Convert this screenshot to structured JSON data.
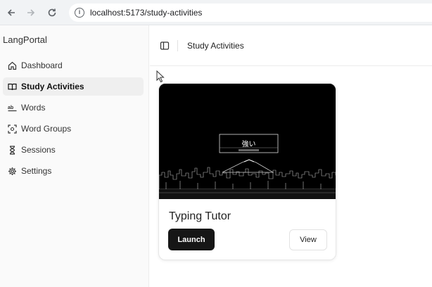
{
  "browser": {
    "url": "localhost:5173/study-activities",
    "back_icon": "arrow-left-icon",
    "forward_icon": "arrow-right-icon",
    "reload_icon": "reload-icon"
  },
  "sidebar": {
    "brand": "LangPortal",
    "items": [
      {
        "label": "Dashboard",
        "icon": "home-icon",
        "active": false
      },
      {
        "label": "Study Activities",
        "icon": "book-open-icon",
        "active": true
      },
      {
        "label": "Words",
        "icon": "whole-word-icon",
        "active": false
      },
      {
        "label": "Word Groups",
        "icon": "word-groups-icon",
        "active": false
      },
      {
        "label": "Sessions",
        "icon": "hourglass-icon",
        "active": false
      },
      {
        "label": "Settings",
        "icon": "gear-icon",
        "active": false
      }
    ]
  },
  "header": {
    "title": "Study Activities"
  },
  "activities": [
    {
      "title": "Typing Tutor",
      "thumbnail_word": "強い",
      "launch_label": "Launch",
      "view_label": "View"
    }
  ]
}
